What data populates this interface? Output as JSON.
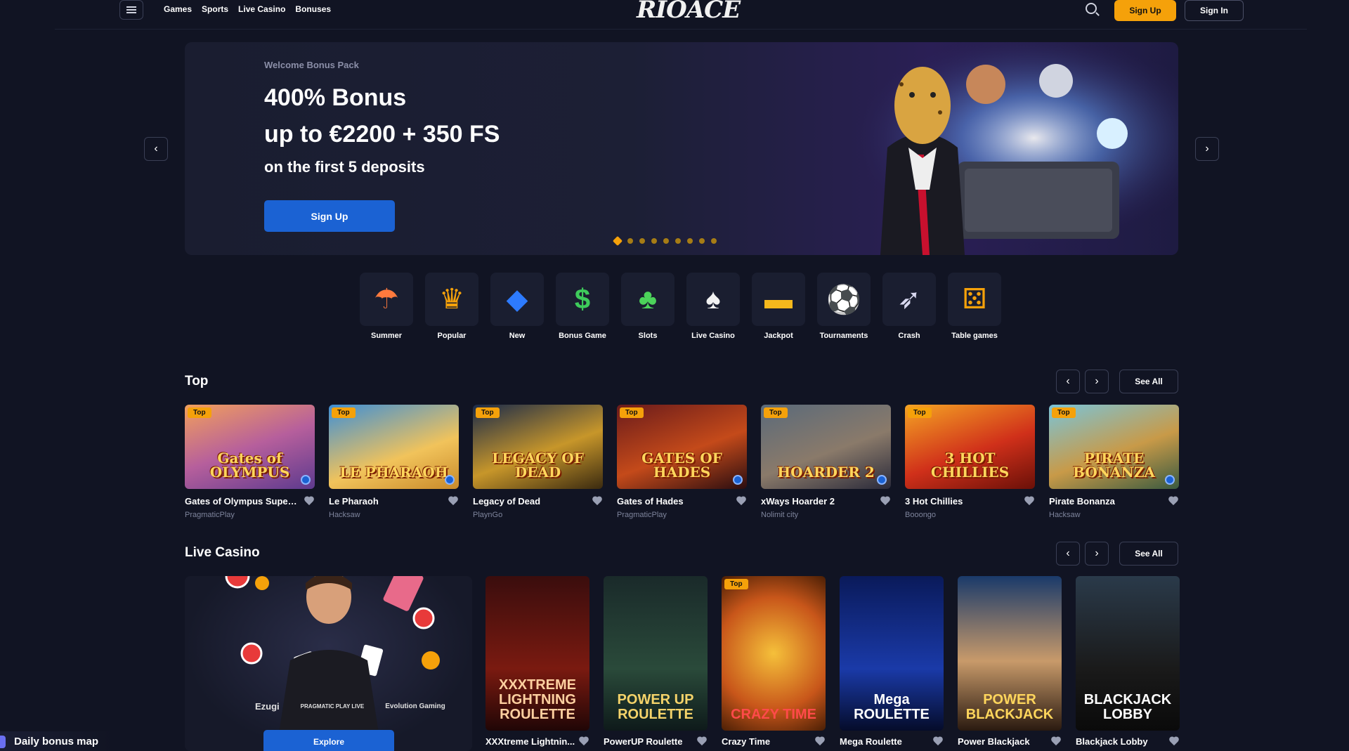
{
  "header": {
    "nav": [
      "Games",
      "Sports",
      "Live Casino",
      "Bonuses"
    ],
    "logo": "RIOACE",
    "signup_label": "Sign Up",
    "signin_label": "Sign In"
  },
  "hero": {
    "eyebrow": "Welcome Bonus Pack",
    "line1": "400% Bonus",
    "line2": "up to €2200 + 350 FS",
    "line3": "on the first 5 deposits",
    "button_label": "Sign Up",
    "slides_total": 9,
    "active_slide": 1
  },
  "categories": [
    {
      "label": "Summer",
      "icon": "umbrella-icon",
      "glyph": "☂",
      "color": "#ff7a3d"
    },
    {
      "label": "Popular",
      "icon": "crown-icon",
      "glyph": "♛",
      "color": "#f5a10a"
    },
    {
      "label": "New",
      "icon": "diamond-icon",
      "glyph": "◆",
      "color": "#2d7bff"
    },
    {
      "label": "Bonus Game",
      "icon": "dollar-icon",
      "glyph": "$",
      "color": "#3ecb5b"
    },
    {
      "label": "Slots",
      "icon": "clover-icon",
      "glyph": "♣",
      "color": "#4cd35a"
    },
    {
      "label": "Live Casino",
      "icon": "cards-icon",
      "glyph": "♠",
      "color": "#f2f2f2"
    },
    {
      "label": "Jackpot",
      "icon": "gold-bar-icon",
      "glyph": "▬",
      "color": "#f5b81c"
    },
    {
      "label": "Tournaments",
      "icon": "soccer-ball-icon",
      "glyph": "⚽",
      "color": "#f2f2f2"
    },
    {
      "label": "Crash",
      "icon": "rocket-icon",
      "glyph": "➶",
      "color": "#d9d9f0"
    },
    {
      "label": "Table games",
      "icon": "dice-icon",
      "glyph": "⚄",
      "color": "#f5a10a"
    }
  ],
  "top_section": {
    "title": "Top",
    "see_all": "See All",
    "games": [
      {
        "name": "Gates of Olympus Super...",
        "provider": "PragmaticPlay",
        "badge": "Top",
        "art": "Gates of OLYMPUS",
        "bg": "linear-gradient(160deg,#f2a05b,#b65f9c 50%,#5d3a8e)",
        "gem": true
      },
      {
        "name": "Le Pharaoh",
        "provider": "Hacksaw",
        "badge": "Top",
        "art": "LE PHARAOH",
        "bg": "linear-gradient(160deg,#3e8fd6,#f1c35b 60%,#c98a2a)",
        "gem": true
      },
      {
        "name": "Legacy of Dead",
        "provider": "PlaynGo",
        "badge": "Top",
        "art": "LEGACY OF DEAD",
        "bg": "linear-gradient(160deg,#1a2a4a,#c7962a 55%,#3a2a10)",
        "gem": false
      },
      {
        "name": "Gates of Hades",
        "provider": "PragmaticPlay",
        "badge": "Top",
        "art": "GATES OF HADES",
        "bg": "linear-gradient(160deg,#6a1b1b,#c44a1a 55%,#2a0d10)",
        "gem": true
      },
      {
        "name": "xWays Hoarder 2",
        "provider": "Nolimit city",
        "badge": "Top",
        "art": "HOARDER 2",
        "bg": "linear-gradient(160deg,#5a6a7a,#8a7a6a 55%,#2a2a3a)",
        "gem": true
      },
      {
        "name": "3 Hot Chillies",
        "provider": "Booongo",
        "badge": "Top",
        "art": "3 HOT CHILLIES",
        "bg": "linear-gradient(160deg,#f5a524,#d0301a 55%,#6a1008)",
        "gem": false
      },
      {
        "name": "Pirate Bonanza",
        "provider": "Hacksaw",
        "badge": "Top",
        "art": "PIRATE BONANZA",
        "bg": "linear-gradient(160deg,#7ac4d8,#c89a48 55%,#3a5a40)",
        "gem": true
      }
    ]
  },
  "live_section": {
    "title": "Live Casino",
    "see_all": "See All",
    "providers": [
      "Ezugi",
      "PRAGMATIC PLAY LIVE",
      "Evolution Gaming"
    ],
    "explore_label": "Explore",
    "games": [
      {
        "name": "XXXtreme Lightnin...",
        "badge": "",
        "art": "XXXTREME LIGHTNING ROULETTE",
        "bg": "linear-gradient(180deg,#3a0d0d,#7a1a10 60%,#200606)",
        "color": "#ffd0a0"
      },
      {
        "name": "PowerUP Roulette",
        "badge": "",
        "art": "POWER UP ROULETTE",
        "bg": "linear-gradient(180deg,#1a2a2a,#2a4a3a 60%,#0e1a1a)",
        "color": "#f5d36a"
      },
      {
        "name": "Crazy Time",
        "badge": "Top",
        "art": "CRAZY TIME",
        "bg": "radial-gradient(circle at 50% 50%,#f5c03a,#c8561a 60%,#4a1f05)",
        "color": "#ff4a4a"
      },
      {
        "name": "Mega Roulette",
        "badge": "",
        "art": "Mega ROULETTE",
        "bg": "linear-gradient(180deg,#0a1a5a,#1a3aa8 60%,#050c2a)",
        "color": "#ffffff"
      },
      {
        "name": "Power Blackjack",
        "badge": "",
        "art": "POWER BLACKJACK",
        "bg": "linear-gradient(180deg,#1a3a6a,#c89a6a 55%,#2a1a10)",
        "color": "#ffd65c"
      },
      {
        "name": "Blackjack Lobby",
        "badge": "",
        "art": "BLACKJACK LOBBY",
        "bg": "linear-gradient(180deg,#2a3a4a,#1a1a1a 60%,#0a0a0a)",
        "color": "#ffffff"
      }
    ]
  },
  "daily_bonus": {
    "label": "Daily bonus map"
  }
}
